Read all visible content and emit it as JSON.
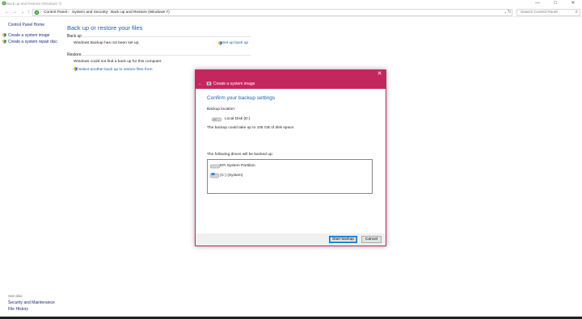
{
  "window": {
    "title": "Back up and Restore (Windows 7)",
    "minimize": "—",
    "maximize": "☐",
    "close": "✕"
  },
  "addressbar": {
    "back": "←",
    "forward": "→",
    "up": "↑",
    "recent": "⌄",
    "crumbs": [
      "Control Panel",
      "System and Security",
      "Back up and Restore (Windows 7)"
    ],
    "separator": "›",
    "dropdown": "⌄",
    "refresh": "↻",
    "search_placeholder": "Search Control Panel",
    "search_icon": "⌕"
  },
  "sidebar": {
    "home": "Control Panel Home",
    "items": [
      "Create a system image",
      "Create a system repair disc"
    ],
    "see_also_label": "See also",
    "see_also": [
      "Security and Maintenance",
      "File History"
    ]
  },
  "main": {
    "title": "Back up or restore your files",
    "backup_section": "Back up",
    "backup_status": "Windows Backup has not been set up.",
    "setup_link": "Set up back up",
    "restore_section": "Restore",
    "restore_status": "Windows could not find a back up for this computer.",
    "restore_link": "Select another back up to restore files from"
  },
  "dialog": {
    "close": "✕",
    "back": "←",
    "title": "Create a system image",
    "heading": "Confirm your backup settings",
    "location_label": "Backup location:",
    "location_value": "Local Disk (D:)",
    "space_text": "The backup could take up to 106 GB of disk space.",
    "drives_label": "The following drives will be backed up:",
    "drives": [
      "EFI System Partition",
      "(C:) (System)"
    ],
    "start_button": "Start backup",
    "cancel_button": "Cancel"
  },
  "colors": {
    "accent": "#c4265e",
    "link": "#1b56b2",
    "heading": "#1e5fa8"
  }
}
